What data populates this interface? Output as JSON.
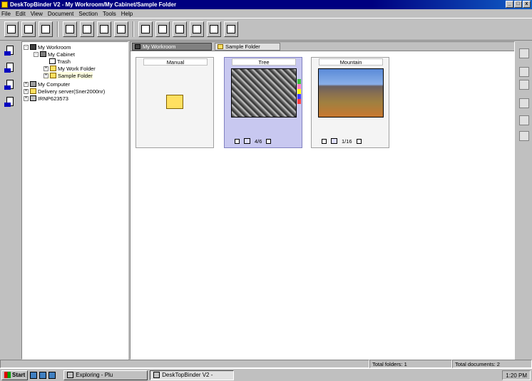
{
  "window": {
    "title": "DeskTopBinder V2 - My Workroom/My Cabinet/Sample Folder",
    "controls": [
      "_",
      "□",
      "x"
    ]
  },
  "menu": [
    "File",
    "Edit",
    "View",
    "Document",
    "Section",
    "Tools",
    "Help"
  ],
  "tree": {
    "items": [
      {
        "label": "My Workroom",
        "expander": "-",
        "icon": "workroom-icon"
      },
      {
        "label": "My Cabinet",
        "expander": "-",
        "icon": "cabinet-icon"
      },
      {
        "label": "Trash",
        "expander": "",
        "icon": "trash-icon"
      },
      {
        "label": "My Work Folder",
        "expander": "+",
        "icon": "folder-icon"
      },
      {
        "label": "Sample Folder",
        "expander": "+",
        "icon": "folder-icon"
      },
      {
        "label": "My Computer",
        "expander": "+",
        "icon": "computer-icon"
      },
      {
        "label": "Delivery server(Sner2000nr)",
        "expander": "+",
        "icon": "server-icon"
      },
      {
        "label": "IRNP623573",
        "expander": "+",
        "icon": "drive-icon"
      }
    ]
  },
  "tabs": [
    {
      "label": "My Workroom",
      "active": true
    },
    {
      "label": "Sample Folder",
      "active": false
    }
  ],
  "cards": [
    {
      "label": "Manual",
      "kind": "folder",
      "page": ""
    },
    {
      "label": "Tree",
      "kind": "photo",
      "page": "4/6"
    },
    {
      "label": "Mountain",
      "kind": "photo",
      "page": "1/16"
    }
  ],
  "status": {
    "folders": "Total folders: 1",
    "documents": "Total documents: 2"
  },
  "taskbar": {
    "start": "Start",
    "tasks": [
      "Exploring - Plu",
      "DeskTopBinder V2 -"
    ],
    "clock": "1:20 PM"
  },
  "colors": {
    "title_bar": "#000080",
    "desktop_face": "#c0c0c0",
    "selected_card": "#c8c8f0"
  }
}
